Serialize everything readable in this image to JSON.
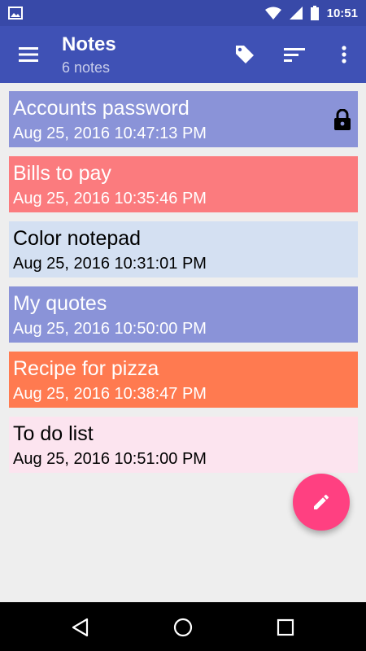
{
  "status_bar": {
    "time": "10:51",
    "icons": [
      "image-icon",
      "wifi-icon",
      "signal-icon",
      "battery-icon"
    ]
  },
  "app_bar": {
    "title": "Notes",
    "subtitle": "6 notes",
    "icons": [
      "menu-icon",
      "tag-icon",
      "sort-icon",
      "more-vert-icon"
    ]
  },
  "notes": [
    {
      "title": "Accounts password",
      "date": "Aug 25, 2016 10:47:13 PM",
      "color": "#8a93d8",
      "locked": true
    },
    {
      "title": "Bills to pay",
      "date": "Aug 25, 2016 10:35:46 PM",
      "color": "#fb7b7e",
      "locked": false
    },
    {
      "title": "Color notepad",
      "date": "Aug 25, 2016 10:31:01 PM",
      "color": "#d4e0f2",
      "locked": false
    },
    {
      "title": "My quotes",
      "date": "Aug 25, 2016 10:50:00 PM",
      "color": "#8a93d8",
      "locked": false
    },
    {
      "title": "Recipe for pizza",
      "date": "Aug 25, 2016 10:38:47 PM",
      "color": "#ff7a50",
      "locked": false
    },
    {
      "title": "To do list",
      "date": "Aug 25, 2016 10:51:00 PM",
      "color": "#fce4ef",
      "locked": false
    }
  ],
  "fab": {
    "icon": "pencil-icon",
    "color": "#ff4081"
  },
  "nav_bar": {
    "icons": [
      "back-icon",
      "home-icon",
      "recents-icon"
    ]
  },
  "colors": {
    "status_bar": "#3849a8",
    "app_bar": "#3f51b5",
    "background": "#eeeeee"
  }
}
